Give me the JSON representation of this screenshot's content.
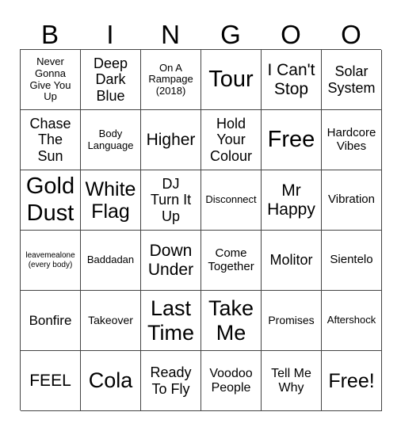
{
  "header": {
    "letters": [
      "B",
      "I",
      "N",
      "G",
      "O",
      "O"
    ]
  },
  "cells": [
    [
      "Never Gonna Give You Up",
      "Deep Dark Blue",
      "On A Rampage (2018)",
      "Tour",
      "I Can't Stop",
      "Solar System"
    ],
    [
      "Chase The Sun",
      "Body Language",
      "Higher",
      "Hold Your Colour",
      "Free",
      "Hardcore Vibes"
    ],
    [
      "Gold Dust",
      "White Flag",
      "DJ Turn It Up",
      "Disconnect",
      "Mr Happy",
      "Vibration"
    ],
    [
      "leavemealone (every body)",
      "Baddadan",
      "Down Under",
      "Come Together",
      "Molitor",
      "Sientelo"
    ],
    [
      "Bonfire",
      "Takeover",
      "Last Time",
      "Take Me",
      "Promises",
      "Aftershock"
    ],
    [
      "FEEL",
      "Cola",
      "Ready To Fly",
      "Voodoo People",
      "Tell Me Why",
      "Free!"
    ]
  ]
}
